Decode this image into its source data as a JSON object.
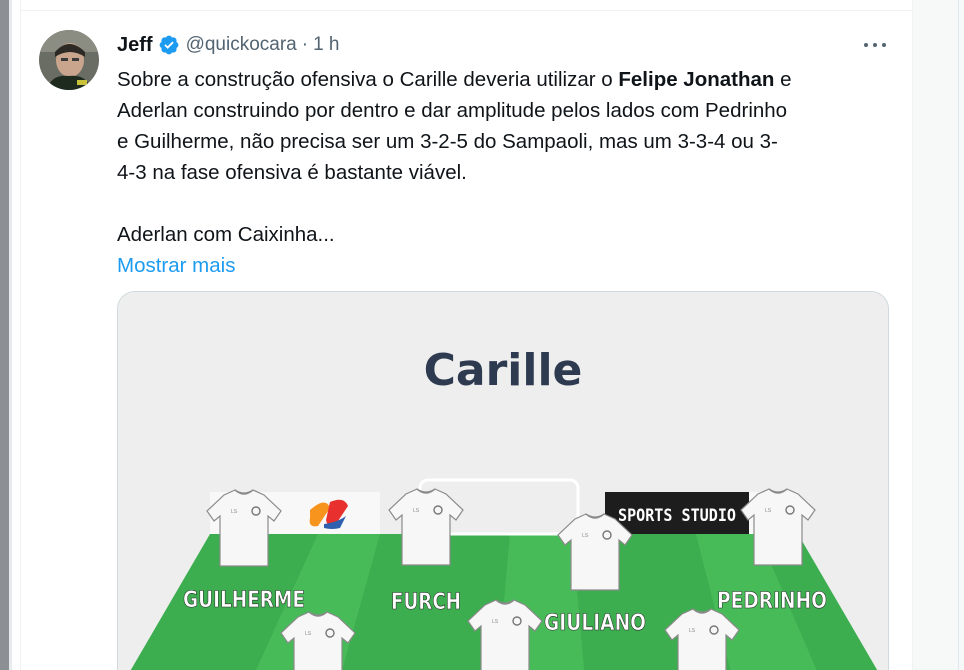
{
  "tweet": {
    "author": {
      "name": "Jeff",
      "handle": "@quickocara",
      "verified": true,
      "time": "1 h",
      "separator": "·"
    },
    "text": {
      "line1_a": "Sobre a construção ofensiva o Carille deveria utilizar o ",
      "line1_bold": "Felipe Jonathan",
      "line1_b": " e",
      "line2": "Aderlan construindo por dentro e dar amplitude pelos lados com Pedrinho",
      "line3": "e Guilherme, não precisa ser um 3-2-5 do Sampaoli, mas um 3-3-4 ou 3-",
      "line4": "4-3 na fase ofensiva é bastante viável.",
      "line5": "Aderlan com Caixinha..."
    },
    "show_more_label": "Mostrar mais",
    "more_menu_icon": "more-horizontal-icon"
  },
  "media": {
    "title": "Carille",
    "sponsor": "SPORTS STUDIO",
    "logo_icon": "ss-logo-icon",
    "players": [
      {
        "label": "GUILHERME"
      },
      {
        "label": "FURCH"
      },
      {
        "label": "GIULIANO"
      },
      {
        "label": "PEDRINHO"
      }
    ],
    "colors": {
      "pitch": "#3dae4f",
      "pitch_light": "#48bb59",
      "title": "#2e3a4f",
      "background": "#eeeeee",
      "sponsor_bg": "#1d1d1d"
    }
  },
  "colors": {
    "link": "#1d9bf0",
    "verified": "#1d9bf0",
    "muted": "#536471",
    "text": "#0f1419"
  }
}
